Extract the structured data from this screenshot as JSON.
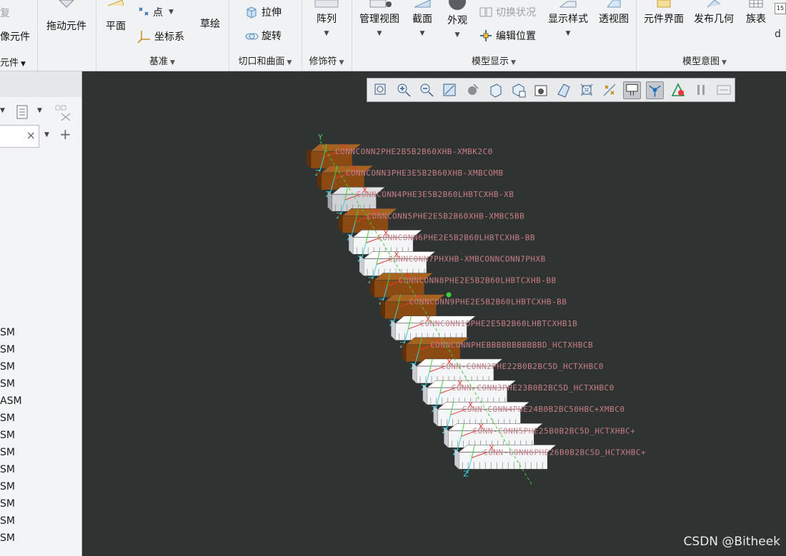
{
  "ribbon": {
    "partial_top_left": "复",
    "partial_left_label": "像元件",
    "drag_component": "拖动元件",
    "plane": "平面",
    "point": "点",
    "csys": "坐标系",
    "sketch": "草绘",
    "extrude": "拉伸",
    "revolve": "旋转",
    "pattern": "阵列",
    "manage_views": "管理视图",
    "section": "截面",
    "appearance": "外观",
    "switch_state": "切换状况",
    "edit_position": "编辑位置",
    "display_style": "显示样式",
    "perspective": "透视图",
    "component_interface": "元件界面",
    "publish_geometry": "发布几何",
    "family_table": "族表",
    "groups": {
      "components": "元件",
      "datum": "基准",
      "cuts_surfaces": "切口和曲面",
      "modifiers": "修饰符",
      "model_display": "模型显示",
      "model_intent": "模型意图"
    }
  },
  "tree": {
    "items": [
      "SM",
      "SM",
      "SM",
      "SM",
      "ASM",
      "SM",
      "SM",
      "SM",
      "SM",
      "SM",
      "SM",
      "SM",
      "SM"
    ]
  },
  "viewport": {
    "toolbar_icons": [
      "zoom-window-icon",
      "zoom-in-icon",
      "zoom-out-icon",
      "refit-icon",
      "shading-icon",
      "view-cube-icon",
      "saved-views-icon",
      "camera-icon",
      "section-icon",
      "spin-center-icon",
      "datum-display-icon",
      "annotation-filter-icon",
      "csys-display-icon",
      "appearance-icon",
      "pause-icon",
      "display-off-icon"
    ],
    "parts": [
      {
        "label": "CONNCONN2PHE2B5B2B60XHB-XMBK2C0",
        "color": "brown"
      },
      {
        "label": "CONNCONN3PHE3E5B2B60XHB-XMBCOMB",
        "color": "brown"
      },
      {
        "label": "CONNCONN4PHE3E5B2B60LHBTCXHB-XB",
        "color": "grey"
      },
      {
        "label": "CONNCONN5PHE2E5B2B60XHB-XMBC5BB",
        "color": "brown"
      },
      {
        "label": "CONNCONN6PHE2E5B2B60LHBTCXHB-BB",
        "color": "white"
      },
      {
        "label": "CONNCONN7PHXHB-XMBCONNCONN7PHXB",
        "color": "white"
      },
      {
        "label": "CONNCONN8PHE2E5B2B60LHBTCXHB-BB",
        "color": "brown"
      },
      {
        "label": "CONNCONN9PHE2E5B2B60LHBTCXHB-BB",
        "color": "brown"
      },
      {
        "label": "CONNCONN1OPHE2E5B2B60LHBTCXHB1B",
        "color": "white"
      },
      {
        "label": "CONNCONNPHEBBBBBBBBBBBD_HCTXHBCB",
        "color": "brown"
      },
      {
        "label": "CONN-CONN2PHE22B0B2BC5D_HCTXHBC0",
        "color": "white"
      },
      {
        "label": "CONN-CONN3PHE23B0B2BC5D_HCTXHBC0",
        "color": "white"
      },
      {
        "label": "CONN-CONN4PHE24B0B2BC50HBC+XMBC0",
        "color": "white"
      },
      {
        "label": "CONN-CONN5PHE25B0B2BC5D_HCTXHBC+",
        "color": "white"
      },
      {
        "label": "CONN-CONN6PHE26B0B2BC5D_HCTXHBC+",
        "color": "white"
      }
    ]
  },
  "watermark": "CSDN @Bitheek"
}
